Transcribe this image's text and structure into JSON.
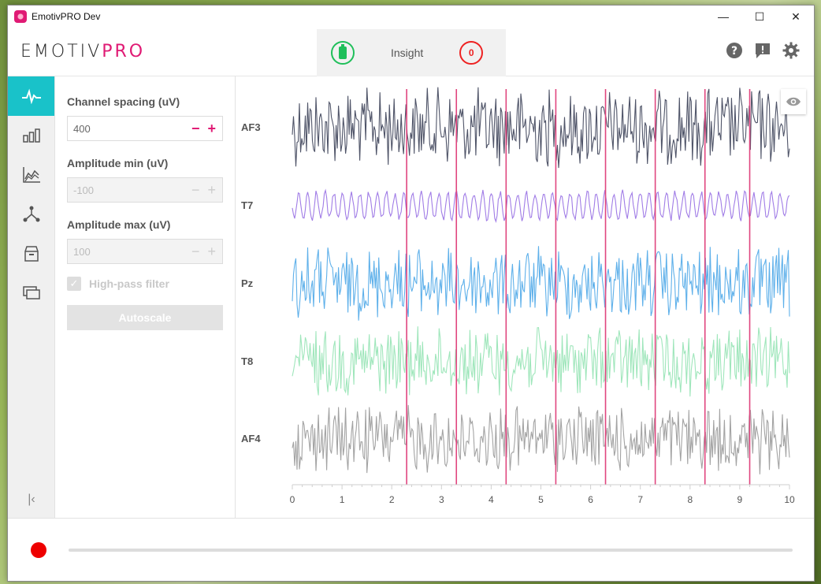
{
  "window": {
    "title": "EmotivPRO  Dev"
  },
  "header": {
    "logo_a": "EMOTIV",
    "logo_b": "PRO",
    "device_name": "Insight",
    "quality_value": "0"
  },
  "panel": {
    "channel_spacing": {
      "label": "Channel spacing (uV)",
      "value": "400"
    },
    "amplitude_min": {
      "label": "Amplitude min (uV)",
      "placeholder": "-100"
    },
    "amplitude_max": {
      "label": "Amplitude max (uV)",
      "placeholder": "100"
    },
    "highpass": {
      "label": "High-pass filter",
      "checked": true
    },
    "autoscale_label": "Autoscale"
  },
  "sidebar": {
    "items": [
      "eeg-waveform-icon",
      "bar-chart-icon",
      "line-chart-icon",
      "network-icon",
      "archive-icon",
      "monitors-icon"
    ],
    "collapse_icon": "collapse-left-icon"
  },
  "chart_data": {
    "type": "line",
    "channels": [
      {
        "name": "AF3",
        "color": "#4f5468"
      },
      {
        "name": "T7",
        "color": "#a07ce6"
      },
      {
        "name": "Pz",
        "color": "#5eb0ea"
      },
      {
        "name": "T8",
        "color": "#9fe6bb"
      },
      {
        "name": "AF4",
        "color": "#a3a3a3"
      }
    ],
    "x_ticks": [
      "0",
      "1",
      "2",
      "3",
      "4",
      "5",
      "6",
      "7",
      "8",
      "9",
      "10"
    ],
    "xlim": [
      0,
      10
    ],
    "markers_x": [
      2.3,
      3.3,
      4.3,
      5.3,
      6.3,
      7.3,
      8.3,
      9.2
    ],
    "marker_color": "#e0467f"
  },
  "footer": {
    "record_color": "#e00000"
  }
}
